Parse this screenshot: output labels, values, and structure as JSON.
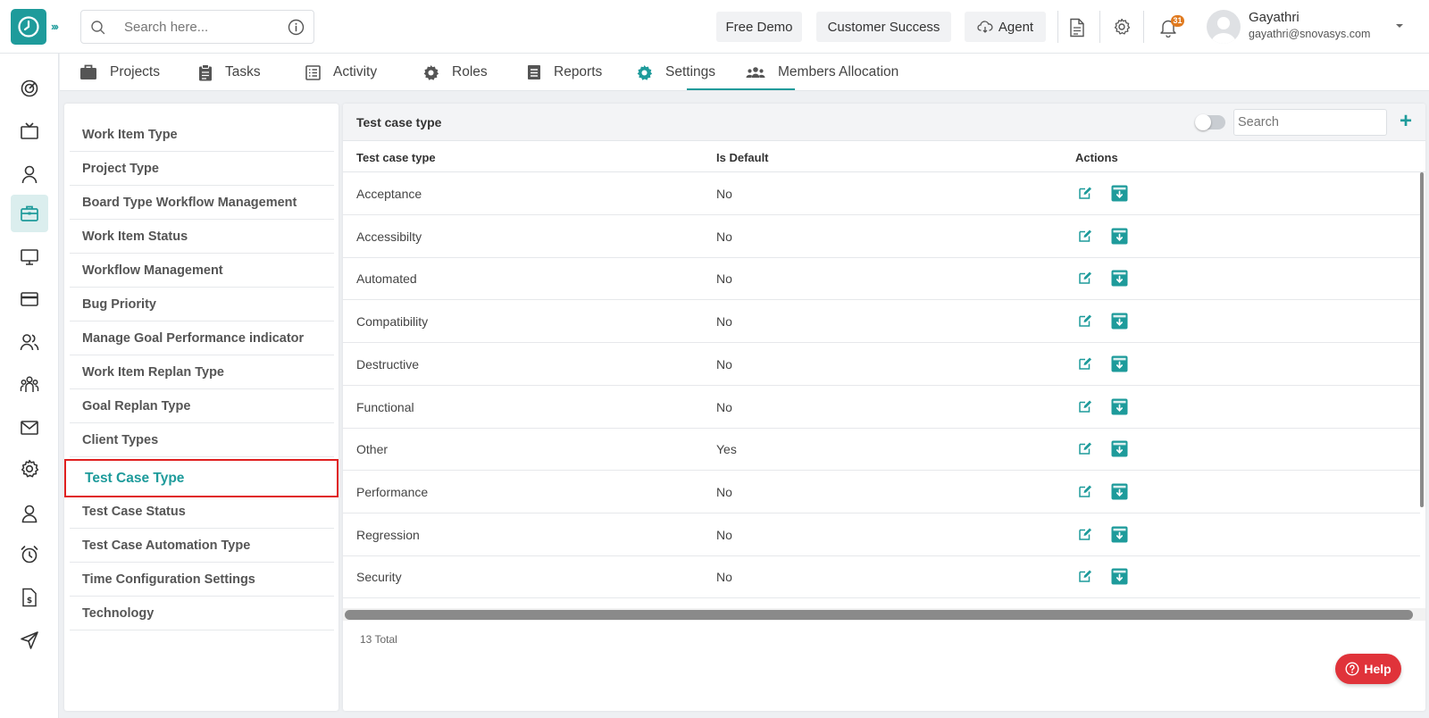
{
  "header": {
    "search_placeholder": "Search here...",
    "free_demo": "Free Demo",
    "customer_success": "Customer Success",
    "agent": "Agent",
    "notification_count": "31",
    "user_name": "Gayathri",
    "user_email": "gayathri@snovasys.com"
  },
  "tabs": [
    {
      "label": "Projects",
      "icon": "briefcase-icon"
    },
    {
      "label": "Tasks",
      "icon": "clipboard-icon"
    },
    {
      "label": "Activity",
      "icon": "activity-list-icon"
    },
    {
      "label": "Roles",
      "icon": "roles-gear-icon"
    },
    {
      "label": "Reports",
      "icon": "reports-icon"
    },
    {
      "label": "Settings",
      "icon": "settings-gear-icon"
    },
    {
      "label": "Members Allocation",
      "icon": "members-icon"
    }
  ],
  "active_tab": "Settings",
  "submenu": {
    "items": [
      "Work Item Type",
      "Project Type",
      "Board Type Workflow Management",
      "Work Item Status",
      "Workflow Management",
      "Bug Priority",
      "Manage Goal Performance indicator",
      "Work Item Replan Type",
      "Goal Replan Type",
      "Client Types",
      "Test Case Type",
      "Test Case Status",
      "Test Case Automation Type",
      "Time Configuration Settings",
      "Technology"
    ],
    "active": "Test Case Type"
  },
  "panel": {
    "title": "Test case type",
    "search_placeholder": "Search",
    "columns": [
      "Test case type",
      "Is Default",
      "Actions"
    ],
    "rows": [
      {
        "type": "Acceptance",
        "default": "No"
      },
      {
        "type": "Accessibilty",
        "default": "No"
      },
      {
        "type": "Automated",
        "default": "No"
      },
      {
        "type": "Compatibility",
        "default": "No"
      },
      {
        "type": "Destructive",
        "default": "No"
      },
      {
        "type": "Functional",
        "default": "No"
      },
      {
        "type": "Other",
        "default": "Yes"
      },
      {
        "type": "Performance",
        "default": "No"
      },
      {
        "type": "Regression",
        "default": "No"
      },
      {
        "type": "Security",
        "default": "No"
      }
    ],
    "total": "13 Total"
  },
  "help_label": "Help",
  "colors": {
    "accent": "#1e9b9b",
    "highlight_border": "#e02020",
    "help_button": "#e0333a",
    "badge": "#e07a1f"
  }
}
